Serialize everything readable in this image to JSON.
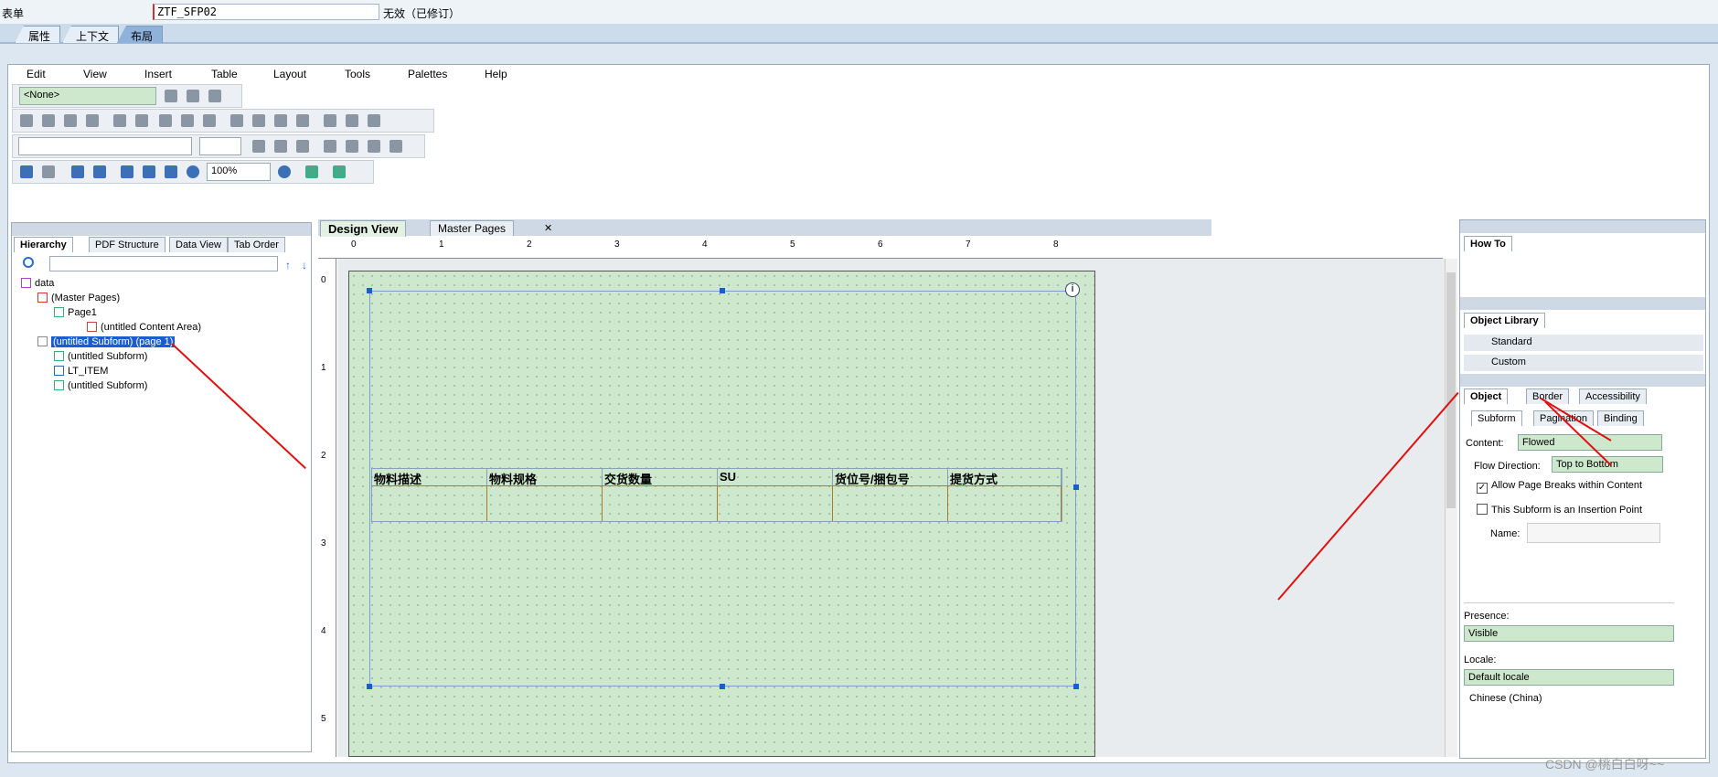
{
  "form": {
    "label": "表单",
    "name": "ZTF_SFP02",
    "status": "无效（已修订）"
  },
  "top_tabs": [
    "属性",
    "上下文",
    "布局"
  ],
  "menu": [
    "Edit",
    "View",
    "Insert",
    "Table",
    "Layout",
    "Tools",
    "Palettes",
    "Help"
  ],
  "toolbar": {
    "style_select": "<None>",
    "zoom": "100%"
  },
  "left_panel": {
    "tabs": [
      "Hierarchy",
      "PDF Structure",
      "Data View",
      "Tab Order"
    ],
    "tree": [
      "data",
      "(Master Pages)",
      "Page1",
      "(untitled Content Area)",
      "(untitled Subform) (page 1)",
      "(untitled Subform)",
      "LT_ITEM",
      "(untitled Subform)"
    ]
  },
  "center": {
    "tabs": [
      "Design View",
      "Master Pages"
    ],
    "ruler_h": [
      "0",
      "1",
      "2",
      "3",
      "4",
      "5",
      "6",
      "7",
      "8"
    ],
    "ruler_v": [
      "0",
      "1",
      "2",
      "3",
      "4",
      "5"
    ],
    "table_headers": [
      "物料描述",
      "物料规格",
      "交货数量",
      "SU",
      "货位号/捆包号",
      "提货方式"
    ]
  },
  "right_panel": {
    "howto_tab": "How To",
    "library_tab": "Object Library",
    "library_items": [
      "Standard",
      "Custom"
    ],
    "object_tabs": [
      "Object",
      "Border",
      "Accessibility"
    ],
    "sub_tabs": [
      "Subform",
      "Pagination",
      "Binding"
    ],
    "content_label": "Content:",
    "content_value": "Flowed",
    "flow_label": "Flow Direction:",
    "flow_value": "Top to Bottom",
    "allow_breaks": "Allow Page Breaks within Content",
    "insertion_point": "This Subform is an Insertion Point",
    "name_label": "Name:",
    "presence_label": "Presence:",
    "presence_value": "Visible",
    "locale_label": "Locale:",
    "locale_value": "Default locale",
    "locale_note": "Chinese (China)"
  },
  "watermark": "CSDN @桃白白呀~~",
  "colors": {
    "canvas": "#cde8cc",
    "selection": "#1a5dcc",
    "arrow": "#e01010"
  }
}
